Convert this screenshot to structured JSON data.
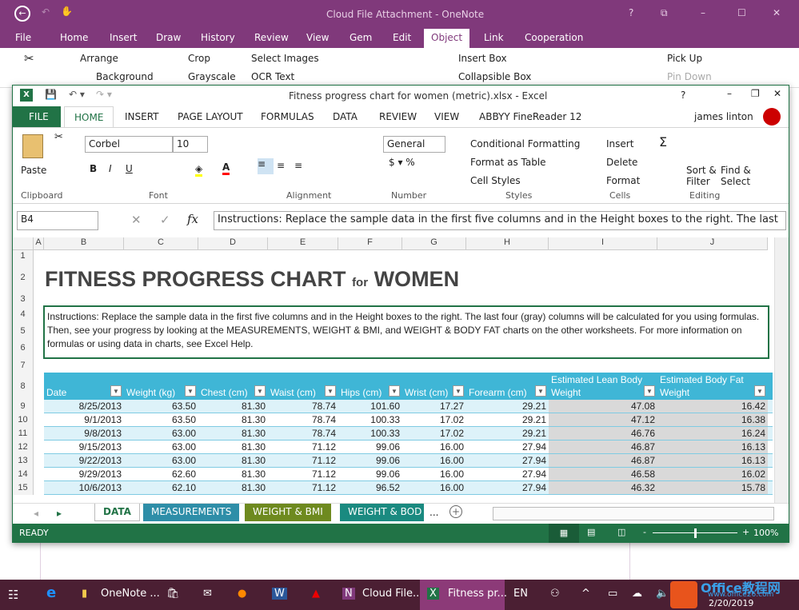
{
  "onenote": {
    "title": "Cloud File Attachment - OneNote",
    "tabs": [
      "File",
      "Home",
      "Insert",
      "Draw",
      "History",
      "Review",
      "View",
      "Gem",
      "Edit",
      "Object",
      "Link",
      "Cooperation"
    ],
    "active_tab": "Object",
    "ribbon": {
      "arrange": "Arrange",
      "background": "Background",
      "crop": "Crop",
      "grayscale": "Grayscale",
      "select_images": "Select Images",
      "ocr_text": "OCR Text",
      "insert_box": "Insert Box",
      "collapsible_box": "Collapsible Box",
      "pick_up": "Pick Up",
      "pin_down": "Pin Down"
    },
    "window_controls": [
      "?",
      "⧉",
      "–",
      "☐",
      "✕"
    ]
  },
  "excel": {
    "title": "Fitness progress chart for women (metric).xlsx - Excel",
    "user": "james linton",
    "tabs": [
      "FILE",
      "HOME",
      "INSERT",
      "PAGE LAYOUT",
      "FORMULAS",
      "DATA",
      "REVIEW",
      "VIEW",
      "ABBYY FineReader 12"
    ],
    "active_tab": "HOME",
    "ribbon": {
      "paste": "Paste",
      "font_name": "Corbel",
      "font_size": "10",
      "number_format": "General",
      "conditional": "Conditional Formatting",
      "format_table": "Format as Table",
      "cell_styles": "Cell Styles",
      "insert": "Insert",
      "delete": "Delete",
      "format": "Format",
      "sort_filter": "Sort & Filter",
      "find_select": "Find & Select",
      "groups": [
        "Clipboard",
        "Font",
        "Alignment",
        "Number",
        "Styles",
        "Cells",
        "Editing"
      ]
    },
    "name_box": "B4",
    "formula": "Instructions: Replace the sample data in the first five columns and in the Height boxes to the right. The last",
    "columns": [
      "A",
      "B",
      "C",
      "D",
      "E",
      "F",
      "G",
      "H",
      "I",
      "J"
    ],
    "sheet_title": "FITNESS PROGRESS CHART",
    "sheet_title_for": "for",
    "sheet_title_women": "WOMEN",
    "instructions": "Instructions: Replace the sample data in the first five columns and in the Height boxes to the right. The last four (gray) columns will be calculated for you using formulas. Then, see your progress by looking at the MEASUREMENTS, WEIGHT & BMI, and WEIGHT & BODY FAT charts on the other worksheets. For more information on formulas or using data in charts, see Excel Help.",
    "table": {
      "headers": [
        "Date",
        "Weight (kg)",
        "Chest (cm)",
        "Waist (cm)",
        "Hips (cm)",
        "Wrist (cm)",
        "Forearm (cm)",
        "Estimated Lean Body Weight",
        "Estimated Body Fat Weight"
      ],
      "rows": [
        {
          "row": "9",
          "cells": [
            "8/25/2013",
            "63.50",
            "81.30",
            "78.74",
            "101.60",
            "17.27",
            "29.21",
            "47.08",
            "16.42"
          ]
        },
        {
          "row": "10",
          "cells": [
            "9/1/2013",
            "63.50",
            "81.30",
            "78.74",
            "100.33",
            "17.02",
            "29.21",
            "47.12",
            "16.38"
          ]
        },
        {
          "row": "11",
          "cells": [
            "9/8/2013",
            "63.00",
            "81.30",
            "78.74",
            "100.33",
            "17.02",
            "29.21",
            "46.76",
            "16.24"
          ]
        },
        {
          "row": "12",
          "cells": [
            "9/15/2013",
            "63.00",
            "81.30",
            "71.12",
            "99.06",
            "16.00",
            "27.94",
            "46.87",
            "16.13"
          ]
        },
        {
          "row": "13",
          "cells": [
            "9/22/2013",
            "63.00",
            "81.30",
            "71.12",
            "99.06",
            "16.00",
            "27.94",
            "46.87",
            "16.13"
          ]
        },
        {
          "row": "14",
          "cells": [
            "9/29/2013",
            "62.60",
            "81.30",
            "71.12",
            "99.06",
            "16.00",
            "27.94",
            "46.58",
            "16.02"
          ]
        },
        {
          "row": "15",
          "cells": [
            "10/6/2013",
            "62.10",
            "81.30",
            "71.12",
            "96.52",
            "16.00",
            "27.94",
            "46.32",
            "15.78"
          ]
        }
      ]
    },
    "sheet_tabs": [
      {
        "label": "DATA",
        "color": "#ffffff"
      },
      {
        "label": "MEASUREMENTS",
        "color": "#2e8ea8"
      },
      {
        "label": "WEIGHT & BMI",
        "color": "#6e8a1f"
      },
      {
        "label": "WEIGHT & BOD",
        "color": "#1a8a80"
      }
    ],
    "more_tabs": "...",
    "status": "READY",
    "zoom": "100%",
    "zoom_level": 100
  },
  "taskbar": {
    "onenote_folder": "OneNote ...",
    "cloud_file": "Cloud File...",
    "fitness": "Fitness pr...",
    "lang": "EN",
    "date": "2/20/2019",
    "watermark": "Office教程网",
    "watermark_url": "www.office26.com"
  },
  "colors": {
    "onenote": "#80397b",
    "excel": "#217346",
    "table_header": "#3fb6d6",
    "band": "#ddf2f9",
    "calc": "#d9d9d9"
  }
}
